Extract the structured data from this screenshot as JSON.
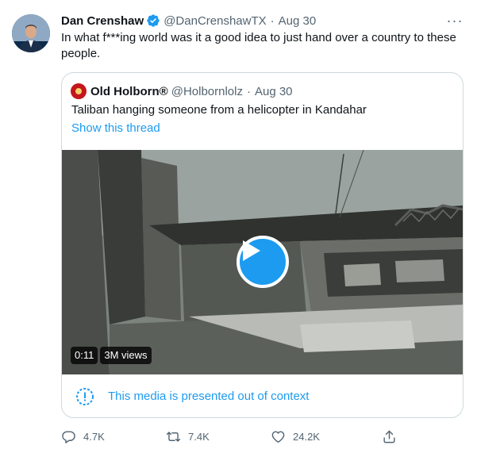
{
  "tweet": {
    "author_name": "Dan Crenshaw",
    "author_handle": "@DanCrenshawTX",
    "separator": "·",
    "date": "Aug 30",
    "more_label": "···",
    "text": "In what f***ing world was it a good idea to just hand over a country to these people."
  },
  "quote": {
    "author_name": "Old Holborn®",
    "author_handle": "@Holbornlolz",
    "separator": "·",
    "date": "Aug 30",
    "text": "Taliban hanging someone from a helicopter in Kandahar",
    "show_thread": "Show this thread",
    "video": {
      "duration": "0:11",
      "views": "3M views"
    },
    "context_notice": "This media is presented out of context"
  },
  "actions": {
    "replies": "4.7K",
    "retweets": "7.4K",
    "likes": "24.2K"
  },
  "icons": {
    "verified": "verified-badge-icon",
    "reply": "reply-icon",
    "retweet": "retweet-icon",
    "like": "heart-icon",
    "share": "share-icon",
    "info": "info-icon",
    "play": "play-icon",
    "more": "more-icon"
  },
  "colors": {
    "accent": "#1d9bf0",
    "text_primary": "#0f1419",
    "text_secondary": "#536471",
    "border": "#cfd9de"
  }
}
